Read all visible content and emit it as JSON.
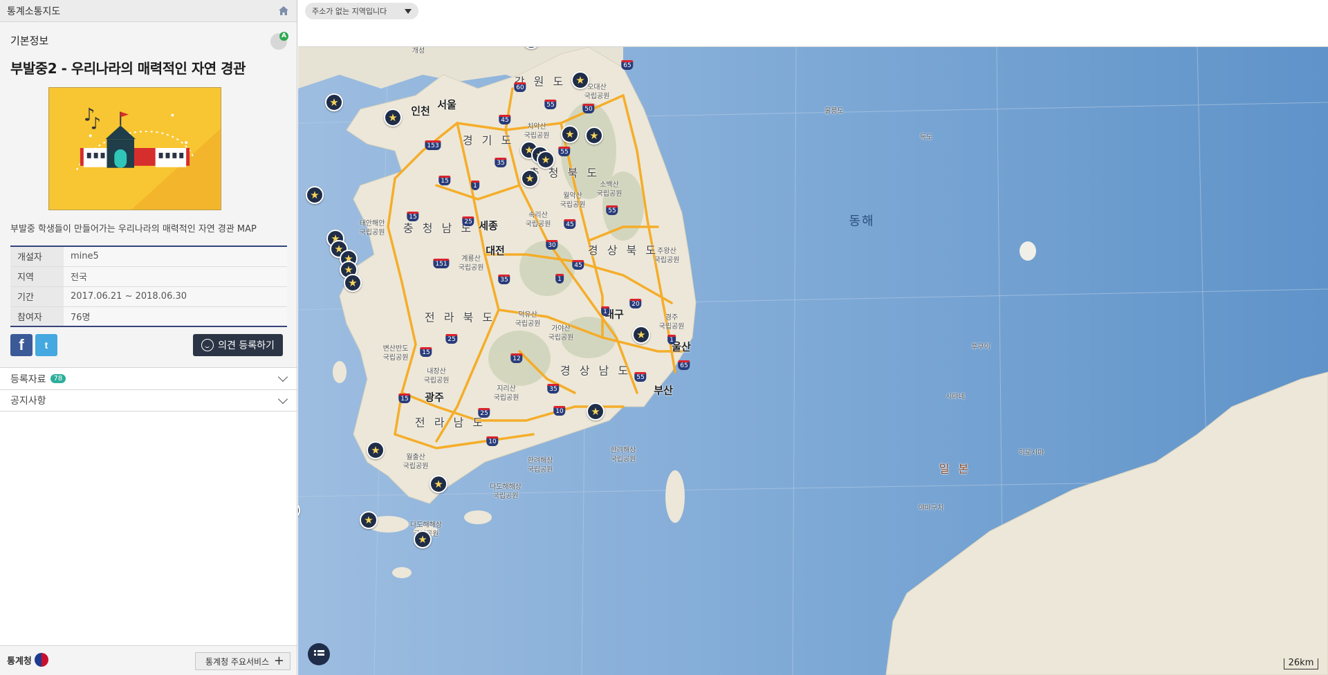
{
  "app": {
    "title": "통계소통지도"
  },
  "panel": {
    "basic_info_label": "기본정보",
    "avatar_badge": "A",
    "map_title": "부발중2 - 우리나라의 매력적인 자연 경관",
    "description": "부발중 학생들이 만들어가는 우리나라의 매력적인 자연 경관 MAP",
    "info": [
      {
        "key": "개설자",
        "value": "mine5"
      },
      {
        "key": "지역",
        "value": "전국"
      },
      {
        "key": "기간",
        "value": "2017.06.21 ~ 2018.06.30"
      },
      {
        "key": "참여자",
        "value": "76명"
      }
    ],
    "facebook_icon": "f",
    "twitter_icon": "t",
    "register_label": "의견 등록하기",
    "registered_label": "등록자료",
    "registered_count": "78",
    "notice_label": "공지사항",
    "footer_logo": "통계청",
    "footer_service": "통계청 주요서비스",
    "footer_plus": "+"
  },
  "topbar": {
    "address_text": "주소가 없는 지역입니다"
  },
  "map": {
    "scale": "26km",
    "colors": {
      "sea": "#8fb3d9",
      "land": "#ece7d8",
      "road": "#f6aa21",
      "marker": "#1f2d48"
    },
    "labels": {
      "gaeseong": "개성",
      "gangwon": "강 원 도",
      "odaesan": "오대산\n국립공원",
      "seoul": "서울",
      "incheon": "인천",
      "ulleungdo": "울릉도",
      "dokdo": "독도",
      "gyeonggi": "경 기 도",
      "chiaksan": "치악산\n국립공원",
      "chungbuk": "충 청 북 도",
      "sobaeksan": "소백산\n국립공원",
      "woraksan": "월악산\n국립공원",
      "taean": "태안해안\n국립공원",
      "chungnam": "충 청 남 도",
      "sejong": "세종",
      "songnisan": "속리산\n국립공원",
      "donghae": "동해",
      "daejeon": "대전",
      "gyeryongsan": "계룡산\n국립공원",
      "gyeongbuk": "경 상 북 도",
      "juwangsan": "주왕산\n국립공원",
      "deogyusan": "덕유산\n국립공원",
      "jeonbuk": "전 라 북 도",
      "daegu": "대구",
      "gayasan": "가야산\n국립공원",
      "gyeongju": "경주\n국립공원",
      "ulsan": "울산",
      "byeonsanbando": "변산반도\n국립공원",
      "naejangsan": "내장산\n국립공원",
      "gyeongnam": "경 상 남 도",
      "hukuoka": "후쿠이",
      "gwangju": "광주",
      "jirisan": "지리산\n국립공원",
      "busan": "부산",
      "jeonnam": "전 라 남 도",
      "shimane": "시마네",
      "hiroshima": "히로시마",
      "hallyeohaesang1": "한려해상\n국립공원",
      "hallyeohaesang2": "한려해상\n국립공원",
      "wolchulsan": "월출산\n국립공원",
      "japan": "일 본",
      "dadohaehaesang1": "다도해해상\n국립공원",
      "dadohaehaesang2": "다도해해상\n국립공원",
      "yamaguchi": "야마구치"
    },
    "highways": [
      "65",
      "60",
      "55",
      "50",
      "45",
      "153",
      "35",
      "55",
      "15",
      "1",
      "15",
      "55",
      "25",
      "45",
      "30",
      "151",
      "35",
      "1",
      "45",
      "20",
      "1",
      "1",
      "65",
      "15",
      "25",
      "12",
      "55",
      "35",
      "15",
      "25",
      "10",
      "10"
    ]
  }
}
